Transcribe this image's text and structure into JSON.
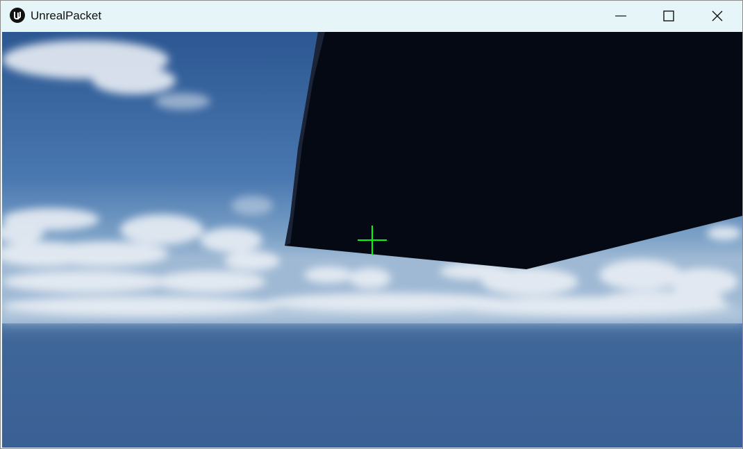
{
  "window": {
    "title": "UnrealPacket",
    "app_icon": "unreal-engine-logo",
    "controls": {
      "minimize_icon": "minimize-icon",
      "maximize_icon": "maximize-icon",
      "close_icon": "close-icon"
    }
  },
  "viewport": {
    "scene": "sky-with-clouds-and-dark-cube-overhead",
    "crosshair_color": "#00ff00",
    "sky_color_top": "#2f5a93",
    "ground_color": "#3d6195",
    "cube_color": "#050a14"
  }
}
